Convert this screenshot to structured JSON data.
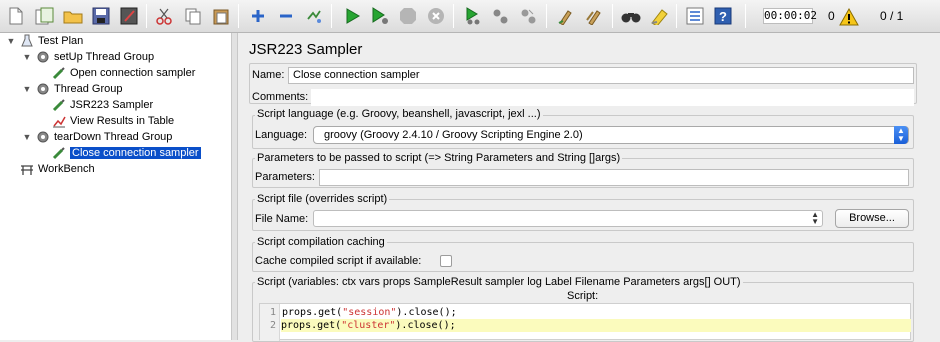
{
  "toolbar": {
    "icons": [
      "new-icon",
      "templates-icon",
      "open-icon",
      "save-icon",
      "save-as-icon",
      "cut-icon",
      "copy-icon",
      "paste-icon",
      "expand-icon",
      "collapse-icon",
      "toggle-icon",
      "start-icon",
      "start-no-pause-icon",
      "stop-icon",
      "shutdown-icon",
      "remote-start-icon",
      "remote-stop-icon",
      "remote-shutdown-icon",
      "clear-icon",
      "clear-all-icon",
      "search-icon",
      "reset-search-icon",
      "function-helper-icon",
      "help-icon",
      "warning-icon"
    ],
    "timer": "00:00:02",
    "warning_count": "0",
    "threads": "0 / 1"
  },
  "tree": {
    "nodes": [
      {
        "label": "Test Plan",
        "icon": "flask-icon"
      },
      {
        "label": "setUp Thread Group",
        "icon": "gear-icon"
      },
      {
        "label": "Open connection sampler",
        "icon": "pipette-icon"
      },
      {
        "label": "Thread Group",
        "icon": "gear-icon"
      },
      {
        "label": "JSR223 Sampler",
        "icon": "pipette-icon"
      },
      {
        "label": "View Results in Table",
        "icon": "chart-icon"
      },
      {
        "label": "tearDown Thread Group",
        "icon": "gear-icon"
      },
      {
        "label": "Close connection sampler",
        "icon": "pipette-icon"
      },
      {
        "label": "WorkBench",
        "icon": "workbench-icon"
      }
    ],
    "selected_index": 7
  },
  "panel": {
    "title": "JSR223 Sampler",
    "name_label": "Name:",
    "name_value": "Close connection sampler",
    "comments_label": "Comments:",
    "script_language": {
      "group_title": "Script language (e.g. Groovy, beanshell, javascript, jexl ...)",
      "label": "Language:",
      "value": "groovy     (Groovy 2.4.10 / Groovy Scripting Engine 2.0)"
    },
    "parameters": {
      "group_title": "Parameters to be passed to script (=> String Parameters and String []args)",
      "label": "Parameters:",
      "value": ""
    },
    "script_file": {
      "group_title": "Script file (overrides script)",
      "label": "File Name:",
      "value": "",
      "browse_label": "Browse..."
    },
    "caching": {
      "group_title": "Script compilation caching",
      "label": "Cache compiled script if available:",
      "checked": false
    },
    "script": {
      "group_title": "Script (variables: ctx vars props SampleResult sampler log Label Filename Parameters args[] OUT)",
      "header": "Script:",
      "lines": [
        {
          "num": "1",
          "pre": "props.get(",
          "str": "\"session\"",
          "post": ").close();"
        },
        {
          "num": "2",
          "pre": "props.get(",
          "str": "\"cluster\"",
          "post": ").close();"
        }
      ]
    }
  }
}
